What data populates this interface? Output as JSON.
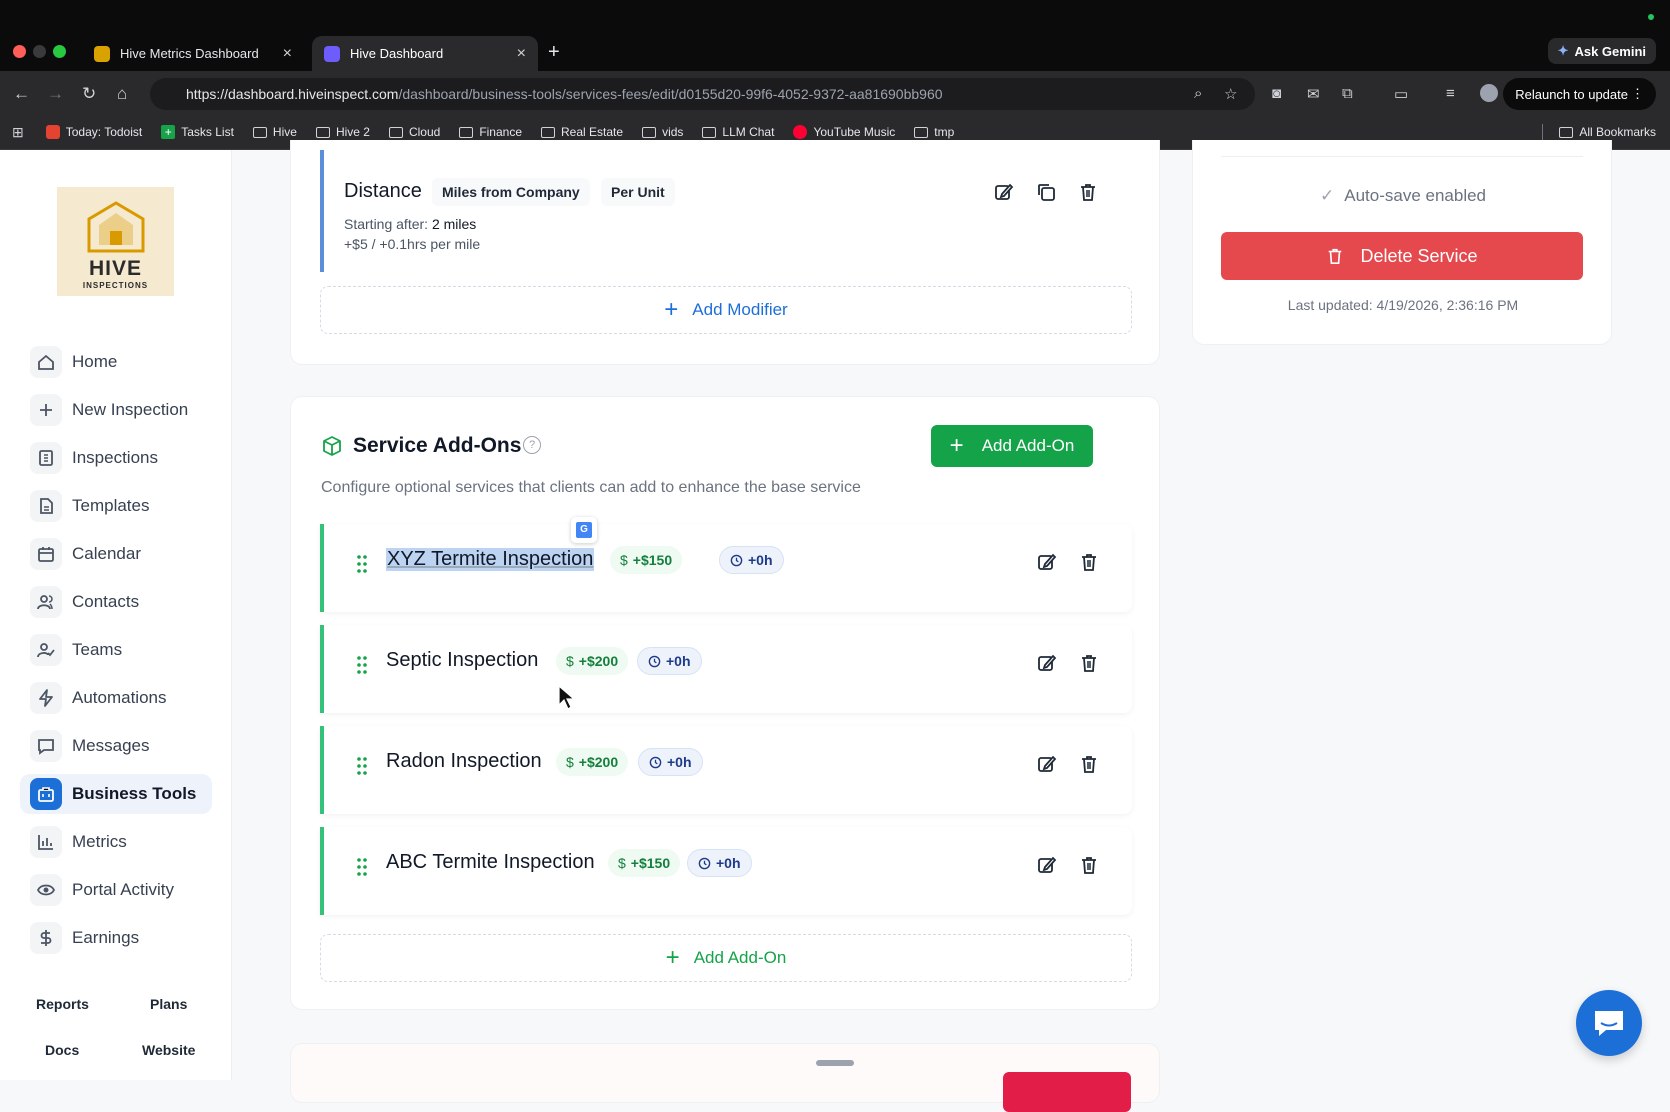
{
  "browser": {
    "tabs": [
      {
        "label": "Hive Metrics Dashboard",
        "active": false
      },
      {
        "label": "Hive Dashboard",
        "active": true
      }
    ],
    "gemini_label": "Ask Gemini",
    "url_domain": "https://dashboard.hiveinspect.com",
    "url_path": "/dashboard/business-tools/services-fees/edit/d0155d20-99f6-4052-9372-aa81690bb960",
    "relaunch_label": "Relaunch to update",
    "bookmarks": [
      "Today: Todoist",
      "Tasks List",
      "Hive",
      "Hive 2",
      "Cloud",
      "Finance",
      "Real Estate",
      "vids",
      "LLM Chat",
      "YouTube Music",
      "tmp"
    ],
    "all_bookmarks": "All Bookmarks"
  },
  "logo": {
    "line1": "HIVE",
    "line2": "INSPECTIONS"
  },
  "sidebar": {
    "items": [
      {
        "label": "Home",
        "icon": "home-icon"
      },
      {
        "label": "New Inspection",
        "icon": "plus-icon"
      },
      {
        "label": "Inspections",
        "icon": "dollar-doc-icon"
      },
      {
        "label": "Templates",
        "icon": "document-icon"
      },
      {
        "label": "Calendar",
        "icon": "calendar-icon"
      },
      {
        "label": "Contacts",
        "icon": "users-icon"
      },
      {
        "label": "Teams",
        "icon": "user-check-icon"
      },
      {
        "label": "Automations",
        "icon": "bolt-icon"
      },
      {
        "label": "Messages",
        "icon": "message-icon"
      },
      {
        "label": "Business Tools",
        "icon": "briefcase-icon",
        "active": true
      },
      {
        "label": "Metrics",
        "icon": "chart-icon"
      },
      {
        "label": "Portal Activity",
        "icon": "eye-icon"
      },
      {
        "label": "Earnings",
        "icon": "dollar-icon"
      }
    ],
    "footer": [
      "Reports",
      "Plans",
      "Docs",
      "Website"
    ]
  },
  "modifier": {
    "title": "Distance",
    "chip1": "Miles from Company",
    "chip2": "Per Unit",
    "starting_prefix": "Starting after: ",
    "starting_value": "2 miles",
    "rate": "+$5 / +0.1hrs per mile",
    "add_label": "Add Modifier"
  },
  "right_panel": {
    "autosave": "Auto-save enabled",
    "delete_label": "Delete Service",
    "last_updated": "Last updated: 4/19/2026, 2:36:16 PM"
  },
  "addons": {
    "title": "Service Add-Ons",
    "description": "Configure optional services that clients can add to enhance the base service",
    "add_button": "Add Add-On",
    "add_bottom": "Add Add-On",
    "items": [
      {
        "name": "XYZ Termite Inspection",
        "price": "+$150",
        "time": "+0h",
        "selected": true
      },
      {
        "name": "Septic Inspection",
        "price": "+$200",
        "time": "+0h"
      },
      {
        "name": "Radon Inspection",
        "price": "+$200",
        "time": "+0h"
      },
      {
        "name": "ABC Termite Inspection",
        "price": "+$150",
        "time": "+0h"
      }
    ]
  },
  "colors": {
    "accent": "#1d6fd8",
    "green": "#15a34a",
    "danger": "#e5484d",
    "chat": "#1d6fd8"
  }
}
